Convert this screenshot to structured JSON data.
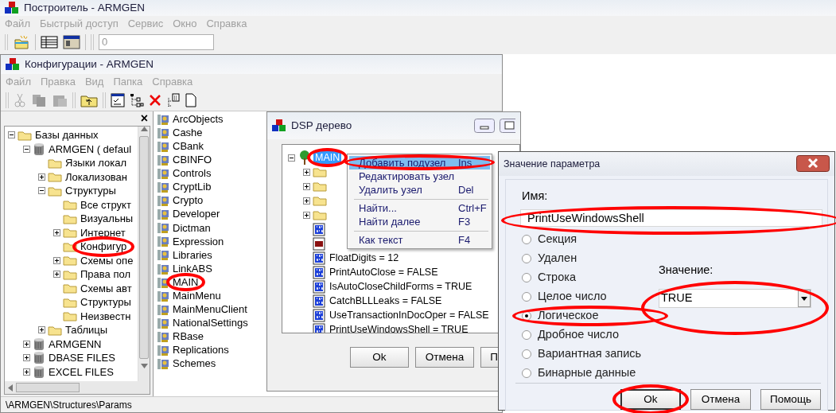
{
  "app_window": {
    "title": "Построитель - ARMGEN",
    "menu": [
      "Файл",
      "Быстрый доступ",
      "Сервис",
      "Окно",
      "Справка"
    ],
    "toolbar_field": {
      "value": "0"
    }
  },
  "config_window": {
    "title": "Конфигурации - ARMGEN",
    "menu": [
      "Файл",
      "Правка",
      "Вид",
      "Папка",
      "Справка"
    ],
    "pane_close": "×",
    "tree": [
      {
        "kind": "folder",
        "label": "Базы данных",
        "has_children": true,
        "expanded": true,
        "children": [
          {
            "kind": "database",
            "label": "ARMGEN ( defaul",
            "has_children": true,
            "expanded": true,
            "children": [
              {
                "kind": "folder",
                "label": "Языки локал",
                "has_children": false
              },
              {
                "kind": "folder",
                "label": "Локализован",
                "has_children": true,
                "expanded": false
              },
              {
                "kind": "folder",
                "label": "Структуры",
                "has_children": true,
                "expanded": true,
                "children": [
                  {
                    "kind": "folder",
                    "label": "Все структ",
                    "has_children": false
                  },
                  {
                    "kind": "folder",
                    "label": "Визуальны",
                    "has_children": false
                  },
                  {
                    "kind": "folder",
                    "label": "Интернет",
                    "has_children": true,
                    "expanded": false
                  },
                  {
                    "kind": "folder",
                    "label": "Конфигур",
                    "has_children": false,
                    "circled": true
                  },
                  {
                    "kind": "folder",
                    "label": "Схемы опе",
                    "has_children": true,
                    "expanded": false
                  },
                  {
                    "kind": "folder",
                    "label": "Права пол",
                    "has_children": true,
                    "expanded": false
                  },
                  {
                    "kind": "folder",
                    "label": "Схемы авт",
                    "has_children": false
                  },
                  {
                    "kind": "folder",
                    "label": "Структуры",
                    "has_children": false
                  },
                  {
                    "kind": "folder",
                    "label": "Неизвестн",
                    "has_children": false
                  }
                ]
              },
              {
                "kind": "folder",
                "label": "Таблицы",
                "has_children": true,
                "expanded": false
              }
            ]
          },
          {
            "kind": "database",
            "label": "ARMGENN",
            "has_children": true,
            "expanded": false
          },
          {
            "kind": "database",
            "label": "DBASE FILES",
            "has_children": true,
            "expanded": false
          },
          {
            "kind": "database",
            "label": "EXCEL FILES",
            "has_children": true,
            "expanded": false
          }
        ]
      }
    ],
    "list": [
      {
        "label": "ArcObjects"
      },
      {
        "label": "Cashe"
      },
      {
        "label": "CBank"
      },
      {
        "label": "CBINFO"
      },
      {
        "label": "Controls"
      },
      {
        "label": "CryptLib"
      },
      {
        "label": "Crypto"
      },
      {
        "label": "Developer"
      },
      {
        "label": "Dictman"
      },
      {
        "label": "Expression"
      },
      {
        "label": "Libraries"
      },
      {
        "label": "LinkABS"
      },
      {
        "label": "MAIN",
        "circled": true
      },
      {
        "label": "MainMenu"
      },
      {
        "label": "MainMenuClient"
      },
      {
        "label": "NationalSettings"
      },
      {
        "label": "RBase"
      },
      {
        "label": "Replications"
      },
      {
        "label": "Schemes"
      }
    ],
    "status_bar": "\\ARMGEN\\Structures\\Params"
  },
  "dsp_window": {
    "title": "DSP дерево",
    "tree": [
      {
        "kind": "tree",
        "label": "MAIN",
        "has_children": true,
        "expanded": true,
        "selected": true,
        "circled": true,
        "children": [
          {
            "kind": "folder",
            "has_children": true,
            "expanded": false,
            "selected": false
          },
          {
            "kind": "folder",
            "has_children": true,
            "expanded": false,
            "selected": false
          },
          {
            "kind": "folder",
            "has_children": true,
            "expanded": false,
            "selected": false
          },
          {
            "kind": "folder",
            "has_children": true,
            "expanded": false,
            "selected": false
          },
          {
            "kind": "param",
            "has_children": false,
            "selected": false
          },
          {
            "kind": "text",
            "has_children": false,
            "selected": false
          },
          {
            "kind": "param",
            "label": "FloatDigits = 12",
            "has_children": false,
            "selected": false
          },
          {
            "kind": "param",
            "label": "PrintAutoClose = FALSE",
            "has_children": false,
            "selected": false
          },
          {
            "kind": "param",
            "label": "IsAutoCloseChildForms = TRUE",
            "has_children": false,
            "selected": false
          },
          {
            "kind": "param",
            "label": "CatchBLLLeaks = FALSE",
            "has_children": false,
            "selected": false
          },
          {
            "kind": "param",
            "label": "UseTransactionInDocOper = FALSE",
            "has_children": false,
            "selected": false
          },
          {
            "kind": "param",
            "label": "PrintUseWindowsShell = TRUE",
            "has_children": false,
            "selected": false
          }
        ]
      }
    ],
    "buttons": [
      "Ok",
      "Отмена",
      "П"
    ]
  },
  "context_menu": {
    "items": [
      {
        "kind": "item",
        "label": "Добавить подузел",
        "shortcut": "Ins",
        "selected": true,
        "circled": true
      },
      {
        "kind": "item",
        "label": "Редактировать узел",
        "selected": false
      },
      {
        "kind": "item",
        "label": "Удалить узел",
        "shortcut": "Del",
        "selected": false
      },
      {
        "kind": "separator"
      },
      {
        "kind": "item",
        "label": "Найти...",
        "shortcut": "Ctrl+F",
        "selected": false
      },
      {
        "kind": "item",
        "label": "Найти далее",
        "shortcut": "F3",
        "selected": false
      },
      {
        "kind": "separator"
      },
      {
        "kind": "item",
        "label": "Как текст",
        "shortcut": "F4",
        "selected": false
      }
    ]
  },
  "param_dialog": {
    "title": "Значение параметра",
    "name_label": "Имя:",
    "name_value": "PrintUseWindowsShell",
    "name_circled": true,
    "types": [
      {
        "label": "Секция",
        "selected": false
      },
      {
        "label": "Удален",
        "selected": false
      },
      {
        "label": "Строка",
        "selected": false
      },
      {
        "label": "Целое число",
        "selected": false
      },
      {
        "label": "Логическое",
        "selected": true,
        "circled": true
      },
      {
        "label": "Дробное число",
        "selected": false
      },
      {
        "label": "Вариантная запись",
        "selected": false
      },
      {
        "label": "Бинарные данные",
        "selected": false
      }
    ],
    "value_label": "Значение:",
    "value": "TRUE",
    "value_circled": true,
    "buttons": [
      {
        "label": "Ok",
        "default": true,
        "circled": true
      },
      {
        "label": "Отмена",
        "default": false
      },
      {
        "label": "Помощь",
        "default": false
      }
    ]
  }
}
